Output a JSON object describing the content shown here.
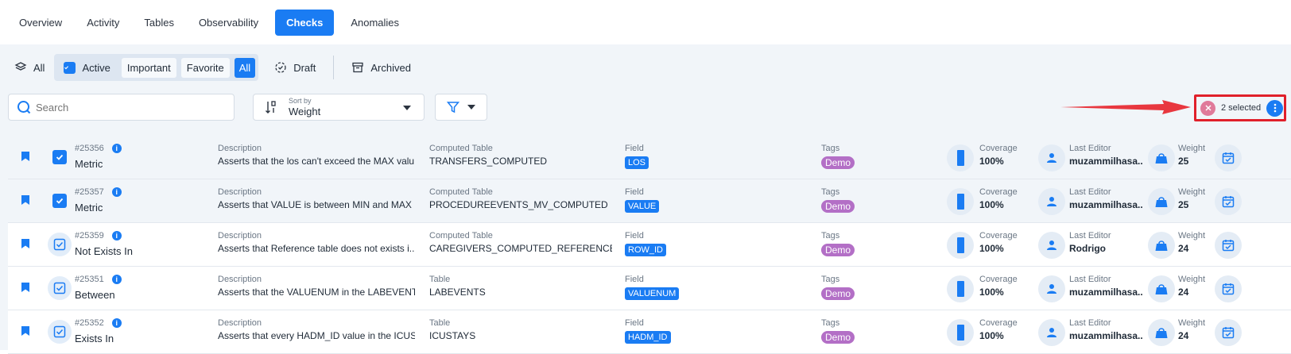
{
  "tabs": [
    {
      "label": "Overview",
      "active": false
    },
    {
      "label": "Activity",
      "active": false
    },
    {
      "label": "Tables",
      "active": false
    },
    {
      "label": "Observability",
      "active": false
    },
    {
      "label": "Checks",
      "active": true
    },
    {
      "label": "Anomalies",
      "active": false
    }
  ],
  "filters": {
    "all_label": "All",
    "active_label": "Active",
    "important_label": "Important",
    "favorite_label": "Favorite",
    "group_all_label": "All",
    "draft_label": "Draft",
    "archived_label": "Archived"
  },
  "search": {
    "placeholder": "Search"
  },
  "sort": {
    "caption": "Sort by",
    "value": "Weight"
  },
  "selection": {
    "text": "2 selected"
  },
  "colors": {
    "accent": "#1a7cf3",
    "tag": "#b36fc6",
    "highlight": "#e0202b"
  },
  "labels": {
    "description": "Description",
    "field": "Field",
    "tags": "Tags",
    "coverage": "Coverage",
    "last_editor": "Last Editor",
    "weight": "Weight"
  },
  "rows": [
    {
      "id": "#25356",
      "type": "Metric",
      "description": "Asserts that the los can't exceed the MAX valu...",
      "table_label": "Computed Table",
      "table": "TRANSFERS_COMPUTED",
      "field": "LOS",
      "tag": "Demo",
      "coverage": "100%",
      "editor": "muzammilhasa...",
      "weight": "25",
      "selected": true
    },
    {
      "id": "#25357",
      "type": "Metric",
      "description": "Asserts that VALUE is between MIN and MAX",
      "table_label": "Computed Table",
      "table": "PROCEDUREEVENTS_MV_COMPUTED",
      "field": "VALUE",
      "tag": "Demo",
      "coverage": "100%",
      "editor": "muzammilhasa...",
      "weight": "25",
      "selected": true
    },
    {
      "id": "#25359",
      "type": "Not Exists In",
      "description": "Asserts that Reference table does not exists i...",
      "table_label": "Computed Table",
      "table": "CAREGIVERS_COMPUTED_REFERENCE",
      "field": "ROW_ID",
      "tag": "Demo",
      "coverage": "100%",
      "editor": "Rodrigo",
      "weight": "24",
      "selected": false
    },
    {
      "id": "#25351",
      "type": "Between",
      "description": "Asserts that the VALUENUM in the LABEVENTS...",
      "table_label": "Table",
      "table": "LABEVENTS",
      "field": "VALUENUM",
      "tag": "Demo",
      "coverage": "100%",
      "editor": "muzammilhasa...",
      "weight": "24",
      "selected": false
    },
    {
      "id": "#25352",
      "type": "Exists In",
      "description": "Asserts that every HADM_ID value in the ICUS...",
      "table_label": "Table",
      "table": "ICUSTAYS",
      "field": "HADM_ID",
      "tag": "Demo",
      "coverage": "100%",
      "editor": "muzammilhasa...",
      "weight": "24",
      "selected": false
    }
  ]
}
